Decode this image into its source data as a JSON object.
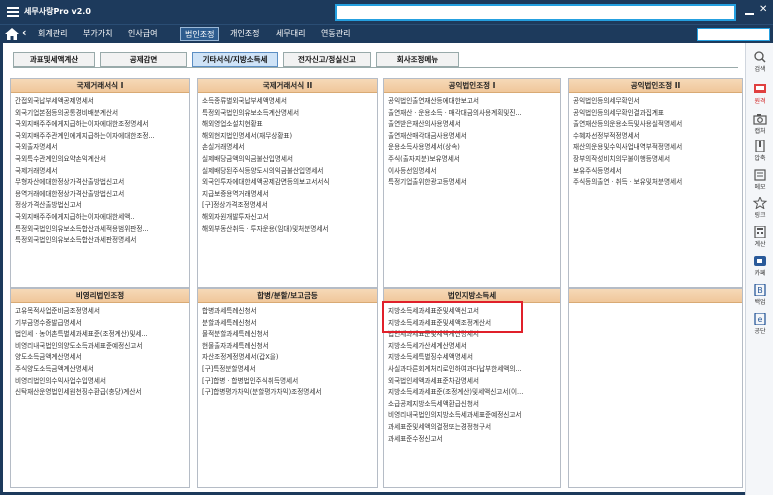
{
  "app": {
    "title": "세무사랑Pro v2.0"
  },
  "menu": {
    "items": [
      "회계관리",
      "부가가치",
      "인사급여",
      "법인조정",
      "개인조정",
      "세무대리",
      "연동관리"
    ],
    "active_index": 3
  },
  "tabs": {
    "items": [
      "과표및세액계산",
      "공제감면",
      "기타서식/지방소득세",
      "전자신고/정실신고",
      "회사조정메뉴"
    ],
    "active_index": 2
  },
  "panels": [
    {
      "title": "국제거래서식 I",
      "items": [
        "간접외국납부세액공제명세서",
        "외국기업본점등의공통경비배분계산서",
        "국외지배주주에게지급하는이자에대한조정명세서",
        "국외지배주주관계인에게지급하는이자에대한조정...",
        "국외출자명세서",
        "국외특수관계인의요약손익계산서",
        "국제거래명세서",
        "무형자산에대한정상가격산출방법신고서",
        "용역거래에대한정상가격산출방법신고서",
        "정상가격산출방법신고서",
        "국외지배주주에게지급하는이자에대한세액..",
        "특정외국법인의유보소득합산과세적용범위판정...",
        "특정외국법인의유보소득합산과세판정명세서"
      ]
    },
    {
      "title": "국제거래서식 II",
      "items": [
        "소득종류별외국납부세액명세서",
        "특정외국법인의유보소득계산명세서",
        "해외영업소설치현황표",
        "해외현지법인명세서(재무상황표)",
        "손실거래명세서",
        "실제배당금액의익금불산입명세서",
        "실제배당된주식등양도시의익금불산입명세서",
        "외국인투자에대한세액공제감면등의보고서서식",
        "지급보증용역거래명세서",
        "[구]정상가격조정명세서",
        "해외자원개발투자신고서",
        "해외부동산취득ㆍ투자운용(임대)및처분명세서"
      ]
    },
    {
      "title": "공익법인조정 I",
      "items": [
        "공익법인출연재산등에대한보고서",
        "출연재산ㆍ운용소득ㆍ매각대금의사용계획및진...",
        "출연받은재산의사용명세서",
        "출연재산매각대금사용명세서",
        "운용소득사용명세서(상속)",
        "주식(출자지분)보유명세서",
        "이사등선임명세서",
        "특정기업출위한광고등명세서"
      ]
    },
    {
      "title": "공익법인조정 II",
      "items": [
        "공익법인등의세무확인서",
        "공익법인등의세무확인결과집계표",
        "출연재산등의운용소득및사용실적명세서",
        "수혜자선정부적정명세서",
        "재산의운용및수익사업내역부적정명세서",
        "장부의작성비치의무불이행등명세서",
        "보유주식등명세서",
        "주식등의출연ㆍ취득ㆍ보유및처분명세서"
      ]
    },
    {
      "title": "비영리법인조정",
      "items": [
        "고유목적사업준비금조정명세서",
        "기부금명수증발급명세서",
        "법인세ㆍ농어촌특별세과세표준(조정계산)및세...",
        "비영리내국법인의양도소득과세표준예정신고서",
        "양도소득금액계산명세서",
        "주식양도소득금액계산명세서",
        "비영리법인의수익사업수입명세서",
        "신탁재산운영법인세원천징수환급(충당)계산서"
      ]
    },
    {
      "title": "합병/분할/보고금등",
      "items": [
        "합병과세특례신청서",
        "분할과세특례신청서",
        "물적분할과세특례신청서",
        "현물출자과세특례신청서",
        "자산조정계정명세서(갑X을)",
        "[구]특정분할명세서",
        "[구]합병ㆍ합병법인주식취득명세서",
        "[구]합병평가차익(분할평가차익)조정명세서"
      ]
    },
    {
      "title": "법인지방소득세",
      "items": [
        "지방소득세과세표준및세액신고서",
        "지방소득세과세표준및세액조정계산서",
        "법인세과세표준및세액계산명세서",
        "지방소득세가산세계산명세서",
        "지방소득세특별징수세액명세서",
        "사실과다른회계처리로인하여과다납부한세액의...",
        "외국법인세액과세표준차감명세서",
        "지방소득세과세표준(조정계산)및세액신고서(이...",
        "소급공제지방소득세액환급신청서",
        "비영리내국법인의지방소득세과세표준예정신고서",
        "과세표준및세액의결정또는경정청구서",
        "과세표준수정신고서"
      ]
    },
    {
      "title": "",
      "items": []
    }
  ],
  "right_sidebar": [
    {
      "label": "검색",
      "icon": "search-icon"
    },
    {
      "label": "원격",
      "icon": "remote-icon"
    },
    {
      "label": "캡처",
      "icon": "camera-icon"
    },
    {
      "label": "압축",
      "icon": "zip-icon"
    },
    {
      "label": "메모",
      "icon": "memo-icon"
    },
    {
      "label": "링크",
      "icon": "star-icon"
    },
    {
      "label": "계산",
      "icon": "calculator-icon"
    },
    {
      "label": "카페",
      "icon": "cafe-icon"
    },
    {
      "label": "백업",
      "icon": "backup-icon"
    },
    {
      "label": "공단",
      "icon": "edge-icon"
    }
  ],
  "colors": {
    "titlebar": "#1d3a5c",
    "accent": "#25a0e0",
    "panel_header": "#f0c79b",
    "highlight": "#e0202a"
  }
}
